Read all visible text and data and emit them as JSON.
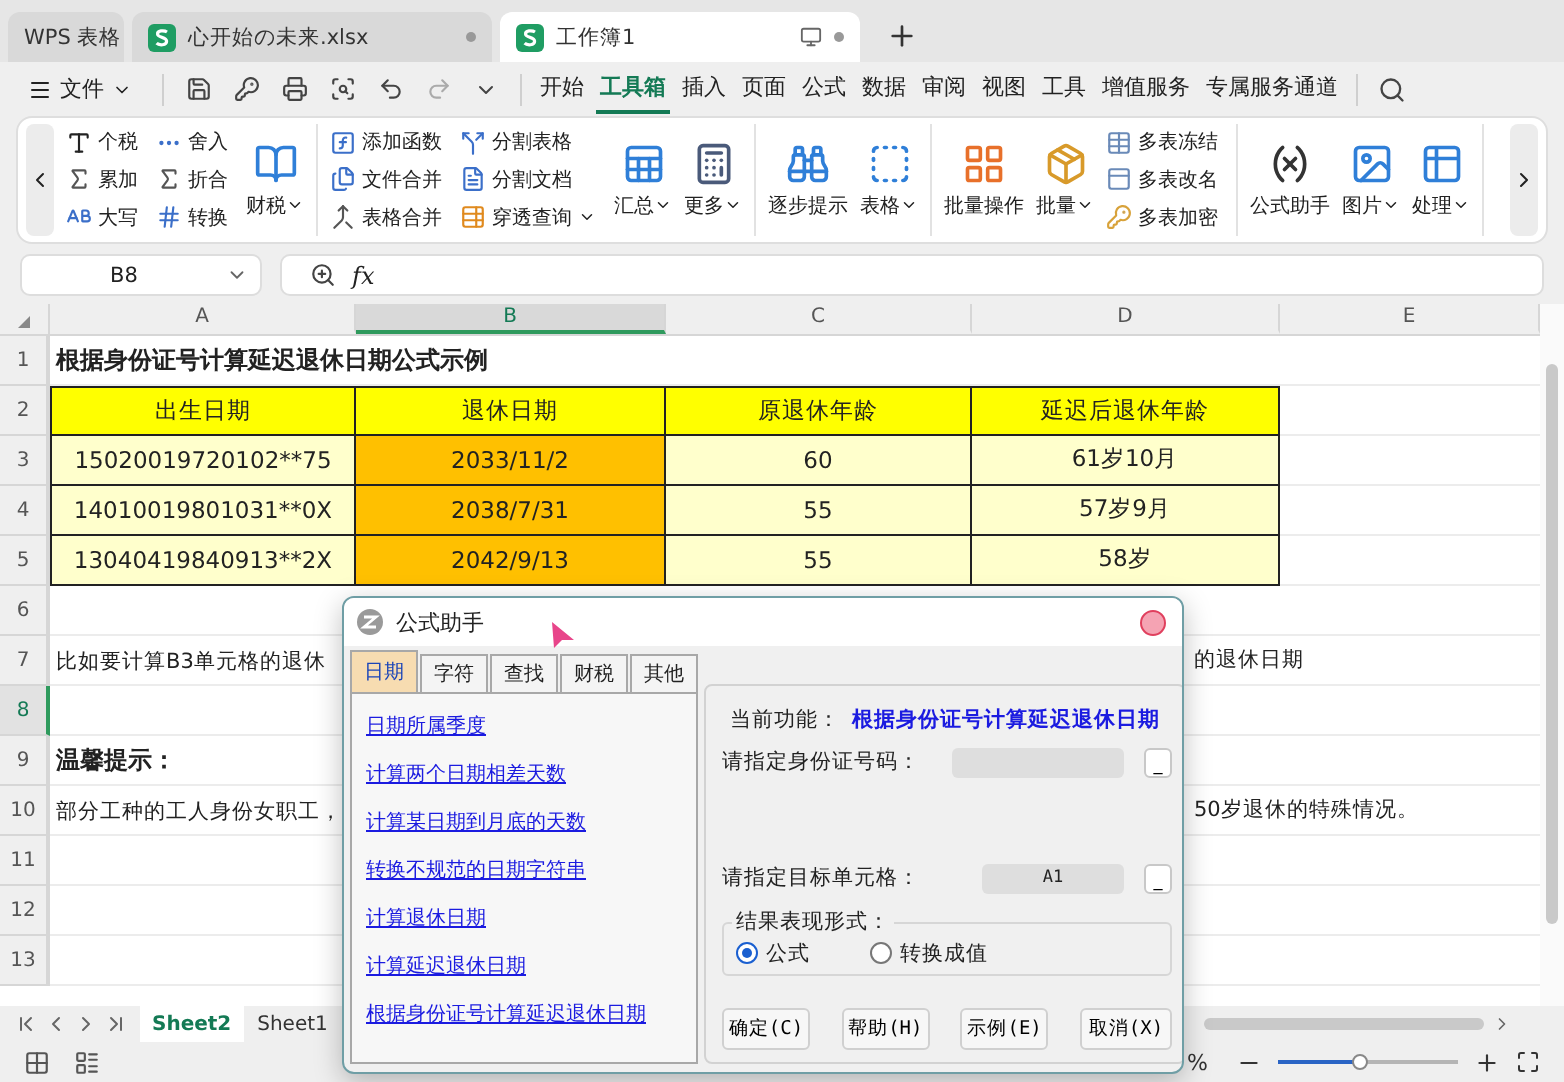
{
  "app_tabs": [
    {
      "label": "WPS 表格",
      "kind": "home",
      "selected": false
    },
    {
      "label": "心开始の未来.xlsx",
      "kind": "document",
      "selected": false
    },
    {
      "label": "工作簿1",
      "kind": "document",
      "selected": true
    }
  ],
  "menu": {
    "file": "文件",
    "items": [
      {
        "label": "开始",
        "selected": false
      },
      {
        "label": "工具箱",
        "selected": true
      },
      {
        "label": "插入",
        "selected": false
      },
      {
        "label": "页面",
        "selected": false
      },
      {
        "label": "公式",
        "selected": false
      },
      {
        "label": "数据",
        "selected": false
      },
      {
        "label": "审阅",
        "selected": false
      },
      {
        "label": "视图",
        "selected": false
      },
      {
        "label": "工具",
        "selected": false
      },
      {
        "label": "增值服务",
        "selected": false
      },
      {
        "label": "专属服务通道",
        "selected": false
      }
    ]
  },
  "ribbon": [
    {
      "columns": [
        {
          "kind": "stack",
          "items": [
            {
              "label": "个税",
              "dropdown": false
            },
            {
              "label": "累加",
              "dropdown": false
            },
            {
              "label": "大写",
              "dropdown": false
            }
          ]
        },
        {
          "kind": "stack",
          "items": [
            {
              "label": "舍入",
              "dropdown": false
            },
            {
              "label": "折合",
              "dropdown": false
            },
            {
              "label": "转换",
              "dropdown": false
            }
          ]
        },
        {
          "kind": "large",
          "items": [
            {
              "label": "财税",
              "dropdown": true
            }
          ]
        }
      ]
    },
    {
      "columns": [
        {
          "kind": "stack",
          "items": [
            {
              "label": "添加函数",
              "dropdown": false
            },
            {
              "label": "文件合并",
              "dropdown": false
            },
            {
              "label": "表格合并",
              "dropdown": false
            }
          ]
        },
        {
          "kind": "stack",
          "items": [
            {
              "label": "分割表格",
              "dropdown": false
            },
            {
              "label": "分割文档",
              "dropdown": false
            },
            {
              "label": "穿透查询",
              "dropdown": true
            }
          ]
        },
        {
          "kind": "large",
          "items": [
            {
              "label": "汇总",
              "dropdown": true
            }
          ]
        },
        {
          "kind": "large",
          "items": [
            {
              "label": "更多",
              "dropdown": true
            }
          ]
        }
      ]
    },
    {
      "columns": [
        {
          "kind": "large",
          "items": [
            {
              "label": "逐步提示",
              "dropdown": false
            }
          ]
        },
        {
          "kind": "large",
          "items": [
            {
              "label": "表格",
              "dropdown": true
            }
          ]
        }
      ]
    },
    {
      "columns": [
        {
          "kind": "large",
          "items": [
            {
              "label": "批量操作",
              "dropdown": false
            }
          ]
        },
        {
          "kind": "large",
          "items": [
            {
              "label": "批量",
              "dropdown": true
            }
          ]
        },
        {
          "kind": "stack",
          "items": [
            {
              "label": "多表冻结",
              "dropdown": false
            },
            {
              "label": "多表改名",
              "dropdown": false
            },
            {
              "label": "多表加密",
              "dropdown": false
            }
          ]
        }
      ]
    },
    {
      "columns": [
        {
          "kind": "large",
          "items": [
            {
              "label": "公式助手",
              "dropdown": false
            }
          ]
        },
        {
          "kind": "large",
          "items": [
            {
              "label": "图片",
              "dropdown": true
            }
          ]
        },
        {
          "kind": "large",
          "items": [
            {
              "label": "处理",
              "dropdown": true
            }
          ]
        }
      ]
    }
  ],
  "formula_bar": {
    "cell": "B8",
    "fx": "fx"
  },
  "columns": [
    {
      "label": "A",
      "selected": false
    },
    {
      "label": "B",
      "selected": true
    },
    {
      "label": "C",
      "selected": false
    },
    {
      "label": "D",
      "selected": false
    },
    {
      "label": "E",
      "selected": false
    }
  ],
  "rows": [
    {
      "number": "1",
      "kind": "title",
      "selected": false,
      "text": "根据身份证号计算延迟退休日期公式示例"
    },
    {
      "number": "2",
      "kind": "table_header",
      "selected": false,
      "cells": [
        "出生日期",
        "退休日期",
        "原退休年龄",
        "延迟后退休年龄"
      ]
    },
    {
      "number": "3",
      "kind": "table_row",
      "selected": false,
      "cells": [
        "15020019720102**75",
        "2033/11/2",
        "60",
        "61岁10月"
      ]
    },
    {
      "number": "4",
      "kind": "table_row",
      "selected": false,
      "cells": [
        "14010019801031**0X",
        "2038/7/31",
        "55",
        "57岁9月"
      ]
    },
    {
      "number": "5",
      "kind": "table_row",
      "selected": false,
      "cells": [
        "13040419840913**2X",
        "2042/9/13",
        "55",
        "58岁"
      ]
    },
    {
      "number": "6",
      "kind": "empty",
      "selected": false
    },
    {
      "number": "7",
      "kind": "note",
      "selected": false,
      "text_left": "比如要计算B3单元格的退休",
      "text_right": "的退休日期"
    },
    {
      "number": "8",
      "kind": "empty",
      "selected": true
    },
    {
      "number": "9",
      "kind": "heading",
      "selected": false,
      "text": "温馨提示："
    },
    {
      "number": "10",
      "kind": "note",
      "selected": false,
      "text_left": "部分工种的工人身份女职工，",
      "text_right": "50岁退休的特殊情况。"
    },
    {
      "number": "11",
      "kind": "empty",
      "selected": false
    },
    {
      "number": "12",
      "kind": "empty",
      "selected": false
    },
    {
      "number": "13",
      "kind": "empty",
      "selected": false
    }
  ],
  "sheet_tabs": [
    {
      "label": "Sheet2",
      "selected": true
    },
    {
      "label": "Sheet1",
      "selected": false
    }
  ],
  "status_bar": {
    "zoom_text": "%",
    "zoom": {
      "level": 0.45
    }
  },
  "dialog": {
    "title": "公式助手",
    "tabs": [
      {
        "label": "日期",
        "selected": true
      },
      {
        "label": "字符",
        "selected": false
      },
      {
        "label": "查找",
        "selected": false
      },
      {
        "label": "财税",
        "selected": false
      },
      {
        "label": "其他",
        "selected": false
      }
    ],
    "links": [
      "日期所属季度",
      "计算两个日期相差天数",
      "计算某日期到月底的天数",
      "转换不规范的日期字符串",
      "计算退休日期",
      "计算延迟退休日期",
      "根据身份证号计算延迟退休日期"
    ],
    "current_label": "当前功能：",
    "current_value": "根据身份证号计算延迟退休日期",
    "fields": [
      {
        "label": "请指定身份证号码：",
        "button": "_"
      },
      {
        "label": "请指定目标单元格：",
        "value": "A1",
        "button": "_"
      }
    ],
    "result_group": "结果表现形式：",
    "options": [
      {
        "label": "公式",
        "selected": true
      },
      {
        "label": "转换成值",
        "selected": false
      }
    ],
    "buttons": [
      "确定(C)",
      "帮助(H)",
      "示例(E)",
      "取消(X)"
    ]
  }
}
